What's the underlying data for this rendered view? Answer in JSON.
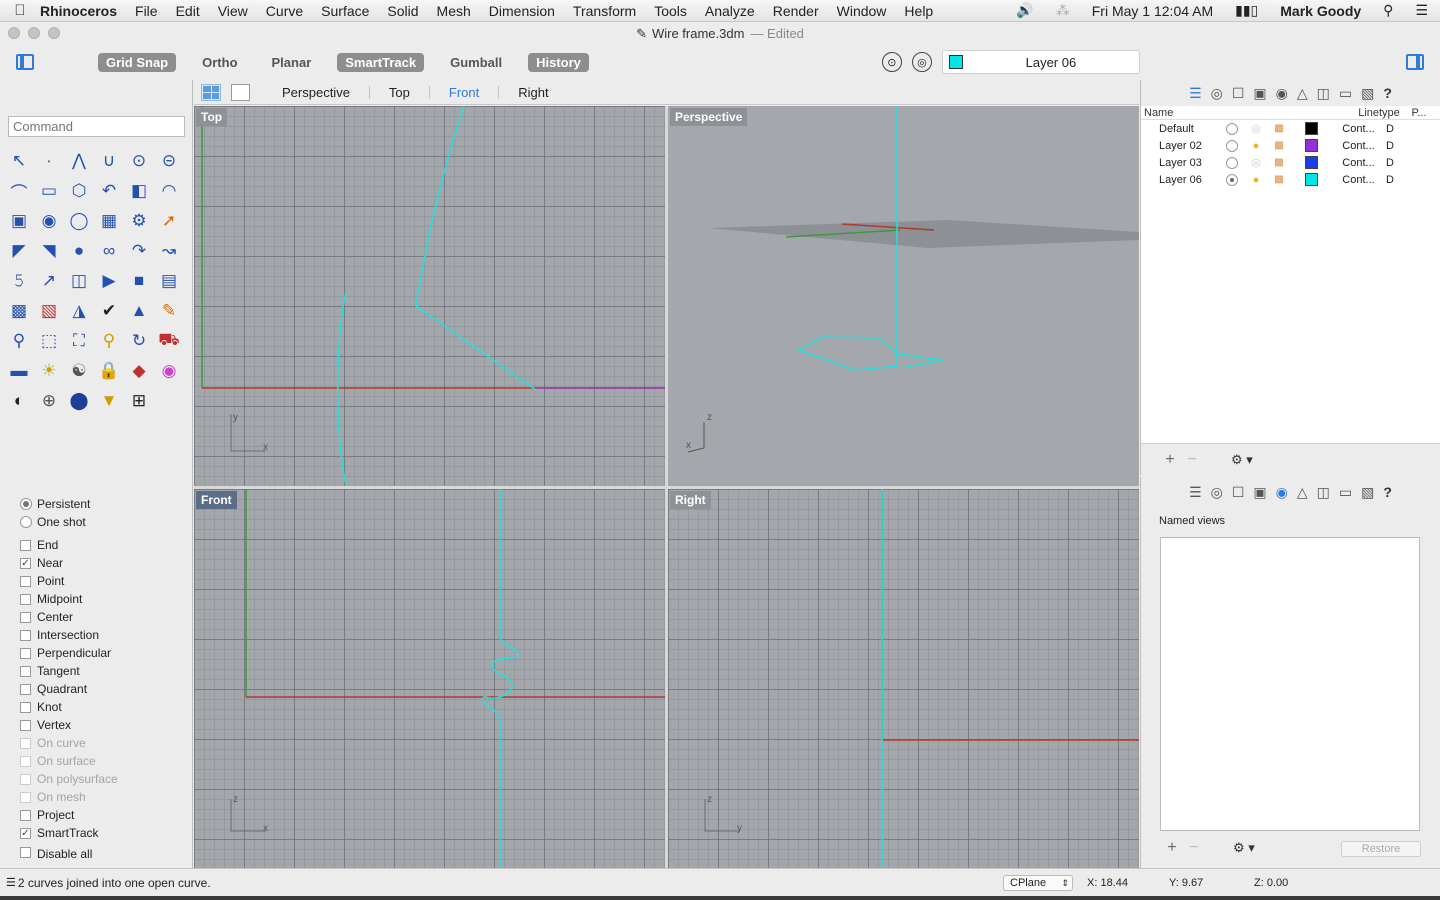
{
  "menubar": {
    "app": "Rhinoceros",
    "items": [
      "File",
      "Edit",
      "View",
      "Curve",
      "Surface",
      "Solid",
      "Mesh",
      "Dimension",
      "Transform",
      "Tools",
      "Analyze",
      "Render",
      "Window",
      "Help"
    ],
    "clock": "Fri May 1  12:04 AM",
    "user": "Mark Goody"
  },
  "window": {
    "title": "Wire frame.3dm",
    "status": "— Edited"
  },
  "toolbar": {
    "grid_snap": "Grid Snap",
    "ortho": "Ortho",
    "planar": "Planar",
    "smarttrack": "SmartTrack",
    "gumball": "Gumball",
    "history": "History",
    "current_layer": "Layer 06",
    "current_layer_color": "#00e5e5"
  },
  "command": {
    "placeholder": "Command"
  },
  "viewport_tabs": {
    "perspective": "Perspective",
    "top": "Top",
    "front": "Front",
    "right": "Right",
    "active": "Front"
  },
  "viewports": {
    "top": "Top",
    "perspective": "Perspective",
    "front": "Front",
    "right": "Right"
  },
  "osnap": {
    "persistent": "Persistent",
    "one_shot": "One shot",
    "items": [
      {
        "label": "End",
        "checked": false
      },
      {
        "label": "Near",
        "checked": true
      },
      {
        "label": "Point",
        "checked": false
      },
      {
        "label": "Midpoint",
        "checked": false
      },
      {
        "label": "Center",
        "checked": false
      },
      {
        "label": "Intersection",
        "checked": false
      },
      {
        "label": "Perpendicular",
        "checked": false
      },
      {
        "label": "Tangent",
        "checked": false
      },
      {
        "label": "Quadrant",
        "checked": false
      },
      {
        "label": "Knot",
        "checked": false
      },
      {
        "label": "Vertex",
        "checked": false
      },
      {
        "label": "On curve",
        "disabled": true
      },
      {
        "label": "On surface",
        "disabled": true
      },
      {
        "label": "On polysurface",
        "disabled": true
      },
      {
        "label": "On mesh",
        "disabled": true
      },
      {
        "label": "Project",
        "checked": false
      },
      {
        "label": "SmartTrack",
        "checked": true
      }
    ],
    "disable_all": "Disable all"
  },
  "layers": {
    "col_name": "Name",
    "col_linetype": "Linetype",
    "col_print": "P...",
    "rows": [
      {
        "name": "Default",
        "color": "#000000",
        "linetype": "Cont...",
        "print": "D",
        "current": false,
        "on": false
      },
      {
        "name": "Layer 02",
        "color": "#9a2ed6",
        "linetype": "Cont...",
        "print": "D",
        "current": false,
        "on": true
      },
      {
        "name": "Layer 03",
        "color": "#1f3bf0",
        "linetype": "Cont...",
        "print": "D",
        "current": false,
        "on": false
      },
      {
        "name": "Layer 06",
        "color": "#00e5e5",
        "linetype": "Cont...",
        "print": "D",
        "current": true,
        "on": true
      }
    ]
  },
  "named_views": {
    "title": "Named views",
    "restore": "Restore"
  },
  "status": {
    "message": "2 curves joined into one open curve.",
    "cplane": "CPlane",
    "x": "X: 18.44",
    "y": "Y: 9.67",
    "z": "Z: 0.00"
  },
  "axis_labels": {
    "x": "x",
    "y": "y",
    "z": "z"
  }
}
